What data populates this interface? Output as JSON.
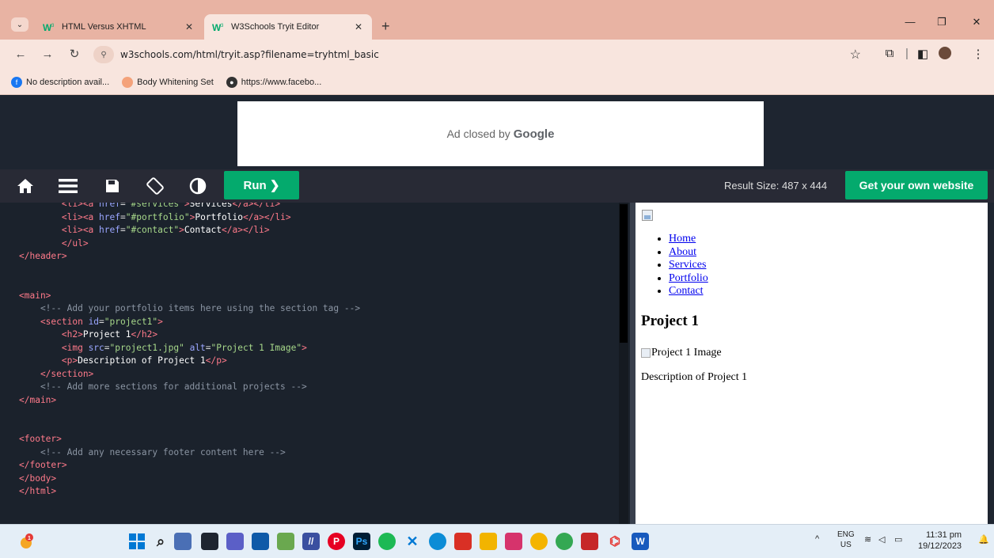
{
  "browser": {
    "tabs": [
      {
        "title": "HTML Versus XHTML",
        "icon": "w3schools-favicon"
      },
      {
        "title": "W3Schools Tryit Editor",
        "icon": "w3schools-favicon"
      }
    ],
    "url": "w3schools.com/html/tryit.asp?filename=tryhtml_basic",
    "bookmarks": [
      {
        "label": "No description avail...",
        "icon": "facebook-icon",
        "color": "#1877f2"
      },
      {
        "label": "Body Whitening Set",
        "icon": "shop-icon",
        "color": "#f4a27a"
      },
      {
        "label": "https://www.facebo...",
        "icon": "globe-icon",
        "color": "#333333"
      }
    ]
  },
  "ad": {
    "text": "Ad closed by",
    "brand": "Google"
  },
  "w3": {
    "run_label": "Run ❯",
    "result_size": "Result Size: 487 x 444",
    "get_website_label": "Get your own website",
    "accent": "#04aa6d"
  },
  "result": {
    "nav_links": [
      "Home",
      "About",
      "Services",
      "Portfolio",
      "Contact"
    ],
    "project_title": "Project 1",
    "project_img_alt": "Project 1 Image",
    "project_desc": "Description of Project 1"
  },
  "taskbar": {
    "lang_top": "ENG",
    "lang_bottom": "US",
    "time": "11:31 pm",
    "date": "19/12/2023",
    "notification_count": "1"
  }
}
